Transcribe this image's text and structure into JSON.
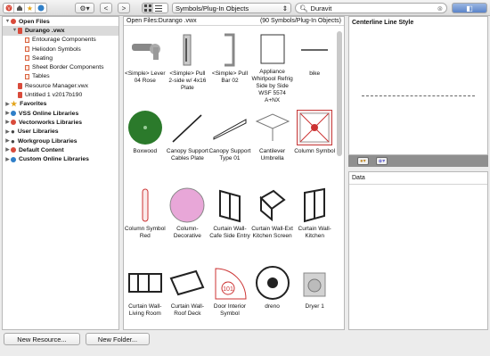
{
  "toolbar": {
    "nav_back": "<",
    "nav_forward": ">",
    "view_dropdown": "Symbols/Plug-In Objects",
    "search_value": "Duravit"
  },
  "tree": {
    "items": [
      {
        "label": "Open Files",
        "level": 0,
        "header": true,
        "icon": "red-dot",
        "expanded": true
      },
      {
        "label": "Durango .vwx",
        "level": 1,
        "header": true,
        "icon": "file-red",
        "expanded": true,
        "selected": true
      },
      {
        "label": "Entourage Components",
        "level": 2,
        "icon": "folder-sheet"
      },
      {
        "label": "Heliodon Symbols",
        "level": 2,
        "icon": "folder-sheet"
      },
      {
        "label": "Seating",
        "level": 2,
        "icon": "folder-sheet"
      },
      {
        "label": "Sheet Border Components",
        "level": 2,
        "icon": "folder-sheet"
      },
      {
        "label": "Tables",
        "level": 2,
        "icon": "folder-sheet"
      },
      {
        "label": "Resource Manager.vwx",
        "level": 1,
        "icon": "file-red"
      },
      {
        "label": "Untitled 1 v2017b190",
        "level": 1,
        "icon": "file-red"
      },
      {
        "label": "Favorites",
        "level": 0,
        "header": true,
        "icon": "star"
      },
      {
        "label": "VSS Online Libraries",
        "level": 0,
        "header": true,
        "icon": "blue-dot"
      },
      {
        "label": "Vectorworks Libraries",
        "level": 0,
        "header": true,
        "icon": "red-dot"
      },
      {
        "label": "User Libraries",
        "level": 0,
        "header": true,
        "icon": "user"
      },
      {
        "label": "Workgroup Libraries",
        "level": 0,
        "header": true,
        "icon": "user"
      },
      {
        "label": "Default Content",
        "level": 0,
        "header": true,
        "icon": "red-dot"
      },
      {
        "label": "Custom Online Libraries",
        "level": 0,
        "header": true,
        "icon": "blue-dot"
      }
    ]
  },
  "center": {
    "header_left": "Open Files:Durango .vwx",
    "header_right": "(90 Symbols/Plug-In Objects)",
    "items": [
      {
        "label": "<Simple> Lever 04 Rose",
        "icon": "lever-icon"
      },
      {
        "label": "<Simple> Pull 2-side w/ 4x16 Plate",
        "icon": "pull-plate-icon"
      },
      {
        "label": "<Simple> Pull Bar 02",
        "icon": "pull-bar-icon"
      },
      {
        "label": "Appliance Whirlpool Refrig Side by Side WSF 5574 A+NX",
        "icon": "refrigerator-icon"
      },
      {
        "label": "bike",
        "icon": "bike-icon"
      },
      {
        "label": "Boxwood",
        "icon": "boxwood-icon"
      },
      {
        "label": "Canopy Support Cables Plate",
        "icon": "canopy-cable-icon"
      },
      {
        "label": "Canopy Support Type 01",
        "icon": "canopy-support-icon"
      },
      {
        "label": "Cantilever Umbrella",
        "icon": "umbrella-icon"
      },
      {
        "label": "Column Symbol",
        "icon": "column-symbol-icon",
        "selected": true
      },
      {
        "label": "Column Symbol Red",
        "icon": "column-red-icon"
      },
      {
        "label": "Column-Decorative",
        "icon": "column-decorative-icon"
      },
      {
        "label": "Curtain Wall-Cafe Side Entry",
        "icon": "curtain-wall-cafe-icon"
      },
      {
        "label": "Curtain Wall-Ext Kitchen Screen",
        "icon": "curtain-wall-kitchen-screen-icon"
      },
      {
        "label": "Curtain Wall-Kitchen",
        "icon": "curtain-wall-kitchen-icon"
      },
      {
        "label": "Curtain Wall-Living Room",
        "icon": "curtain-wall-living-icon"
      },
      {
        "label": "Curtain Wall-Roof Deck",
        "icon": "curtain-wall-roof-icon"
      },
      {
        "label": "Door Interior Symbol",
        "icon": "door-symbol-icon",
        "tag": "101"
      },
      {
        "label": "dreno",
        "icon": "drain-icon"
      },
      {
        "label": "Dryer 1",
        "icon": "dryer-icon"
      }
    ]
  },
  "preview": {
    "title": "Centerline Line Style"
  },
  "data_panel": {
    "title": "Data"
  },
  "bottom": {
    "new_resource": "New Resource...",
    "new_folder": "New Folder..."
  },
  "colors": {
    "accent_red": "#d94b3b",
    "online_blue": "#2f7fc8",
    "selection_red": "#c53a3a"
  }
}
